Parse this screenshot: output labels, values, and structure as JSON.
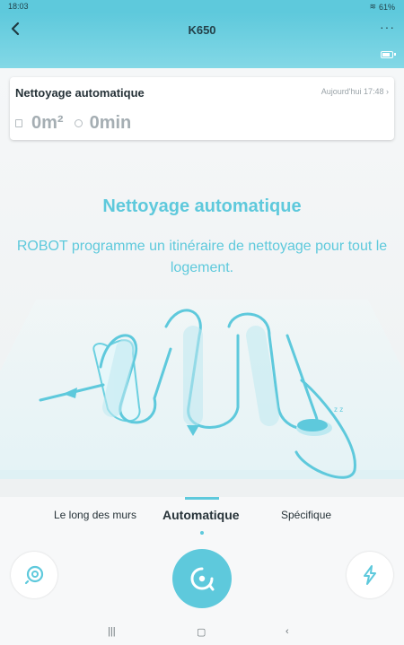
{
  "status": {
    "time": "18:03",
    "battery": "61%"
  },
  "header": {
    "title": "K650",
    "more": "···"
  },
  "card": {
    "title": "Nettoyage automatique",
    "date": "Aujourd'hui 17:48",
    "area": "0m²",
    "duration": "0min"
  },
  "mode": {
    "title": "Nettoyage automatique",
    "description": "ROBOT programme un itinéraire de nettoyage pour tout le logement."
  },
  "tabs": {
    "items": [
      "Le long des murs",
      "Automatique",
      "Spécifique"
    ],
    "active_index": 1
  },
  "colors": {
    "accent": "#5ec9dc",
    "text": "#263238"
  },
  "icons": {
    "left_button": "spot-clean-icon",
    "center_button": "robot-start-icon",
    "right_button": "lightning-icon"
  }
}
